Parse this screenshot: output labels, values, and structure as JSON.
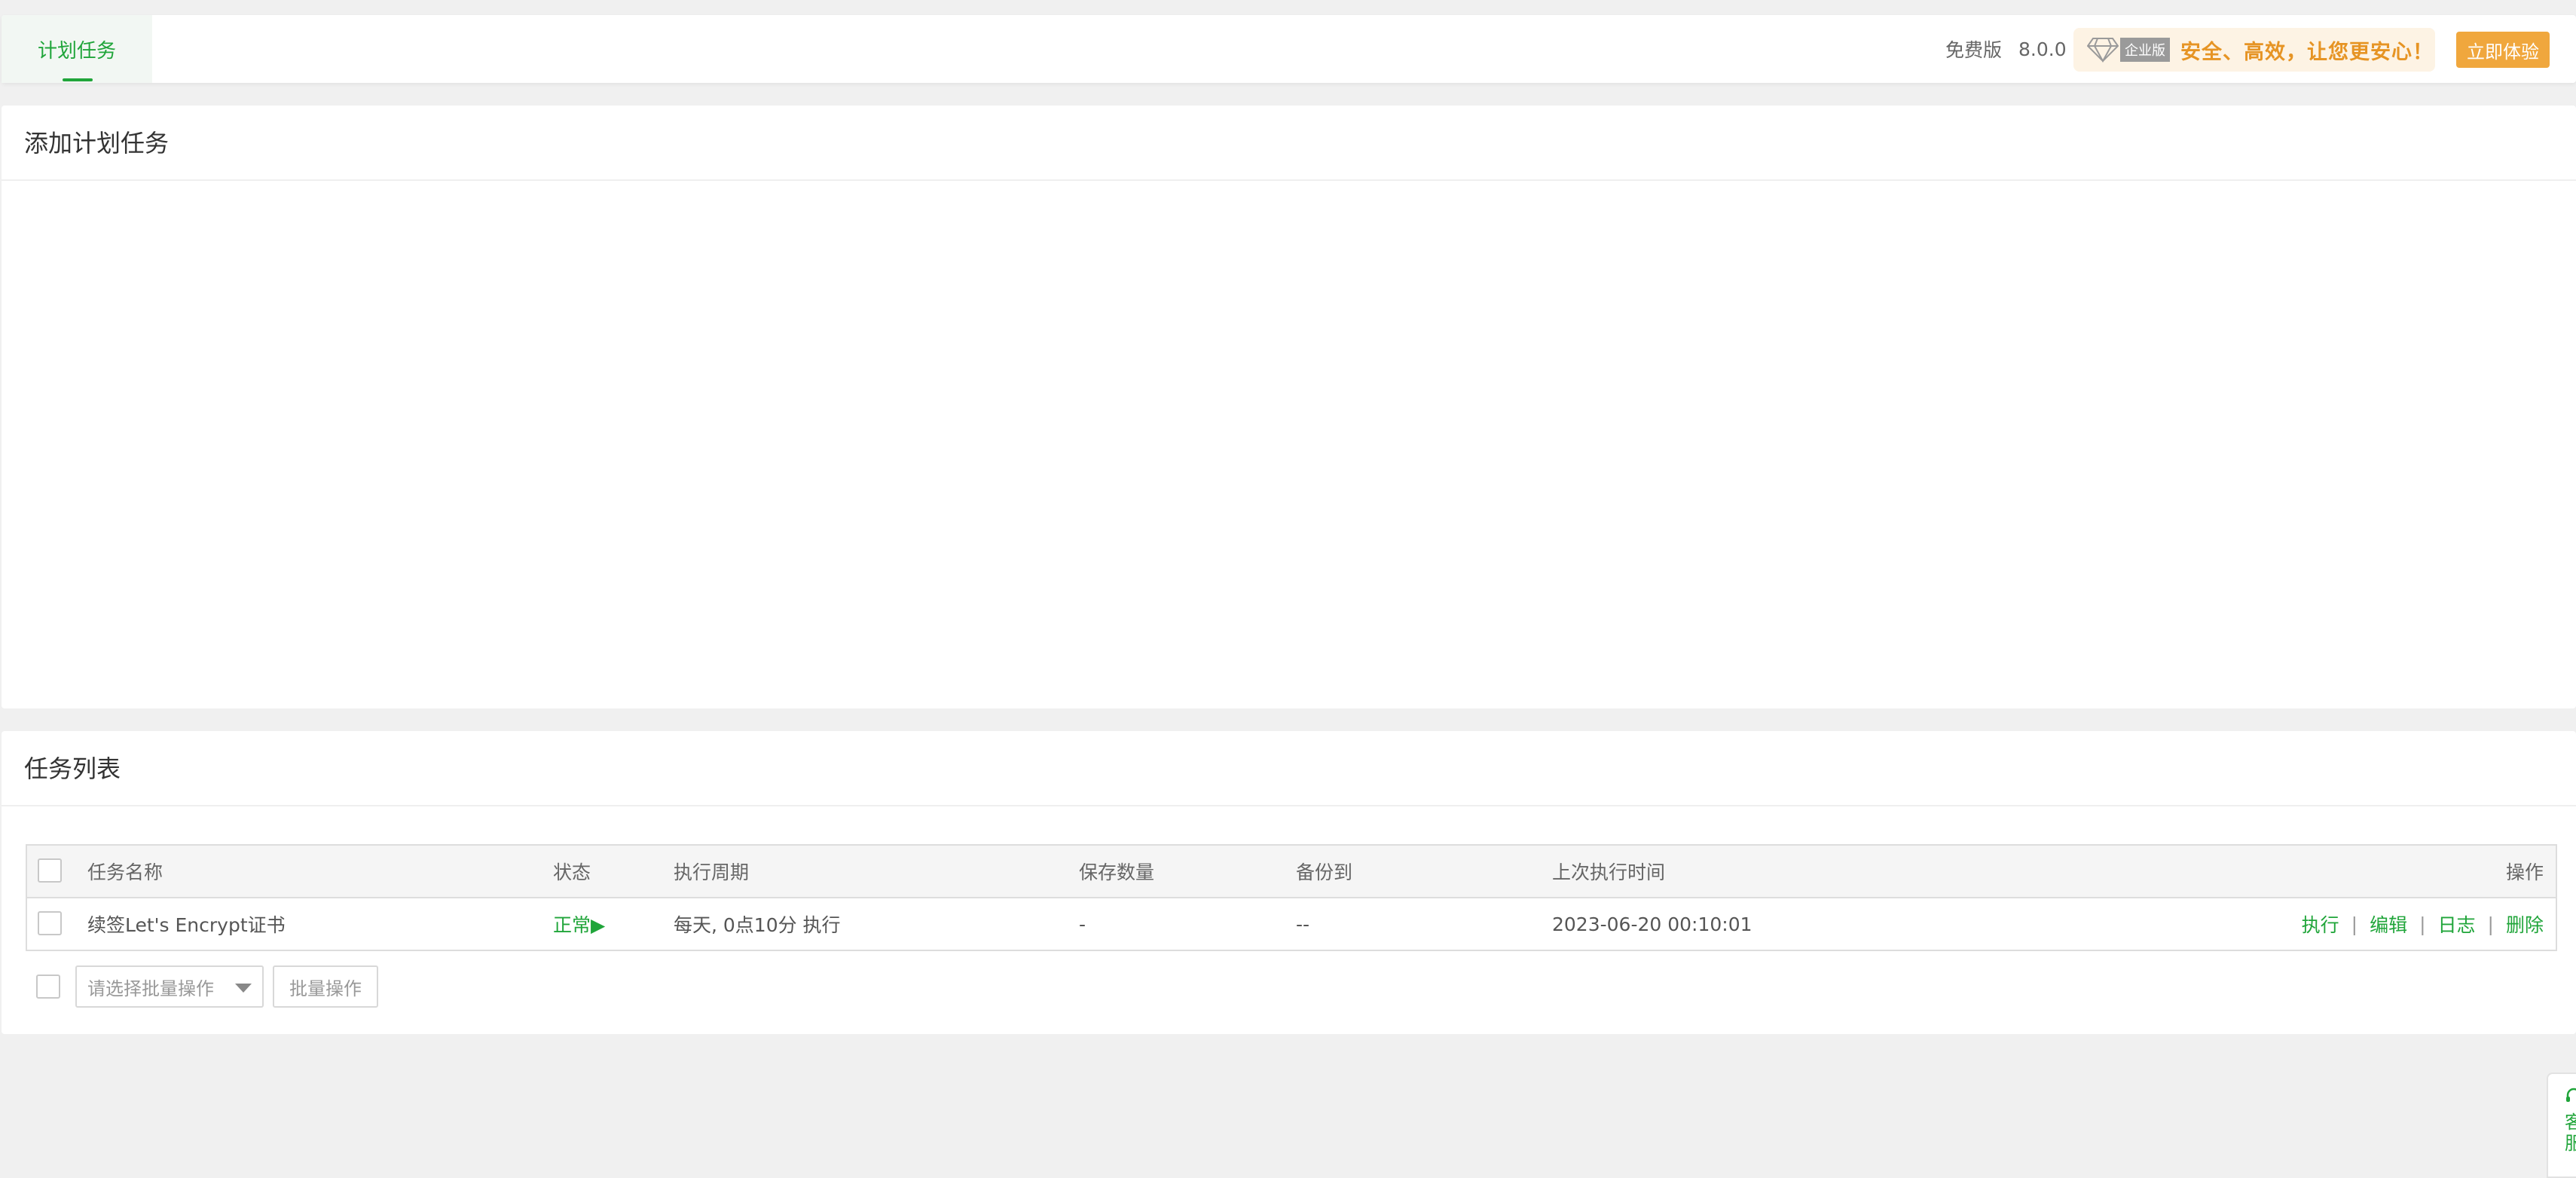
{
  "header": {
    "tab_label": "计划任务",
    "edition": "免费版",
    "version": "8.0.0",
    "promo_badge": "企业版",
    "promo_slogan": "安全、高效，让您更安心！",
    "trial_button": "立即体验",
    "accent_color": "#20a53a",
    "promo_color": "#e69424",
    "trial_color": "#f0a73d"
  },
  "add_panel": {
    "title": "添加计划任务"
  },
  "list_panel": {
    "title": "任务列表",
    "columns": [
      "任务名称",
      "状态",
      "执行周期",
      "保存数量",
      "备份到",
      "上次执行时间",
      "操作"
    ],
    "rows": [
      {
        "name": "续签Let's Encrypt证书",
        "status": "正常▶",
        "cycle": "每天, 0点10分 执行",
        "keep": "-",
        "backup_to": "--",
        "last_run": "2023-06-20 00:10:01",
        "actions": [
          "执行",
          "编辑",
          "日志",
          "删除"
        ]
      }
    ],
    "batch_placeholder": "请选择批量操作",
    "batch_button": "批量操作"
  },
  "service_widget": {
    "label": "客服",
    "icon": "customer-service-icon"
  }
}
